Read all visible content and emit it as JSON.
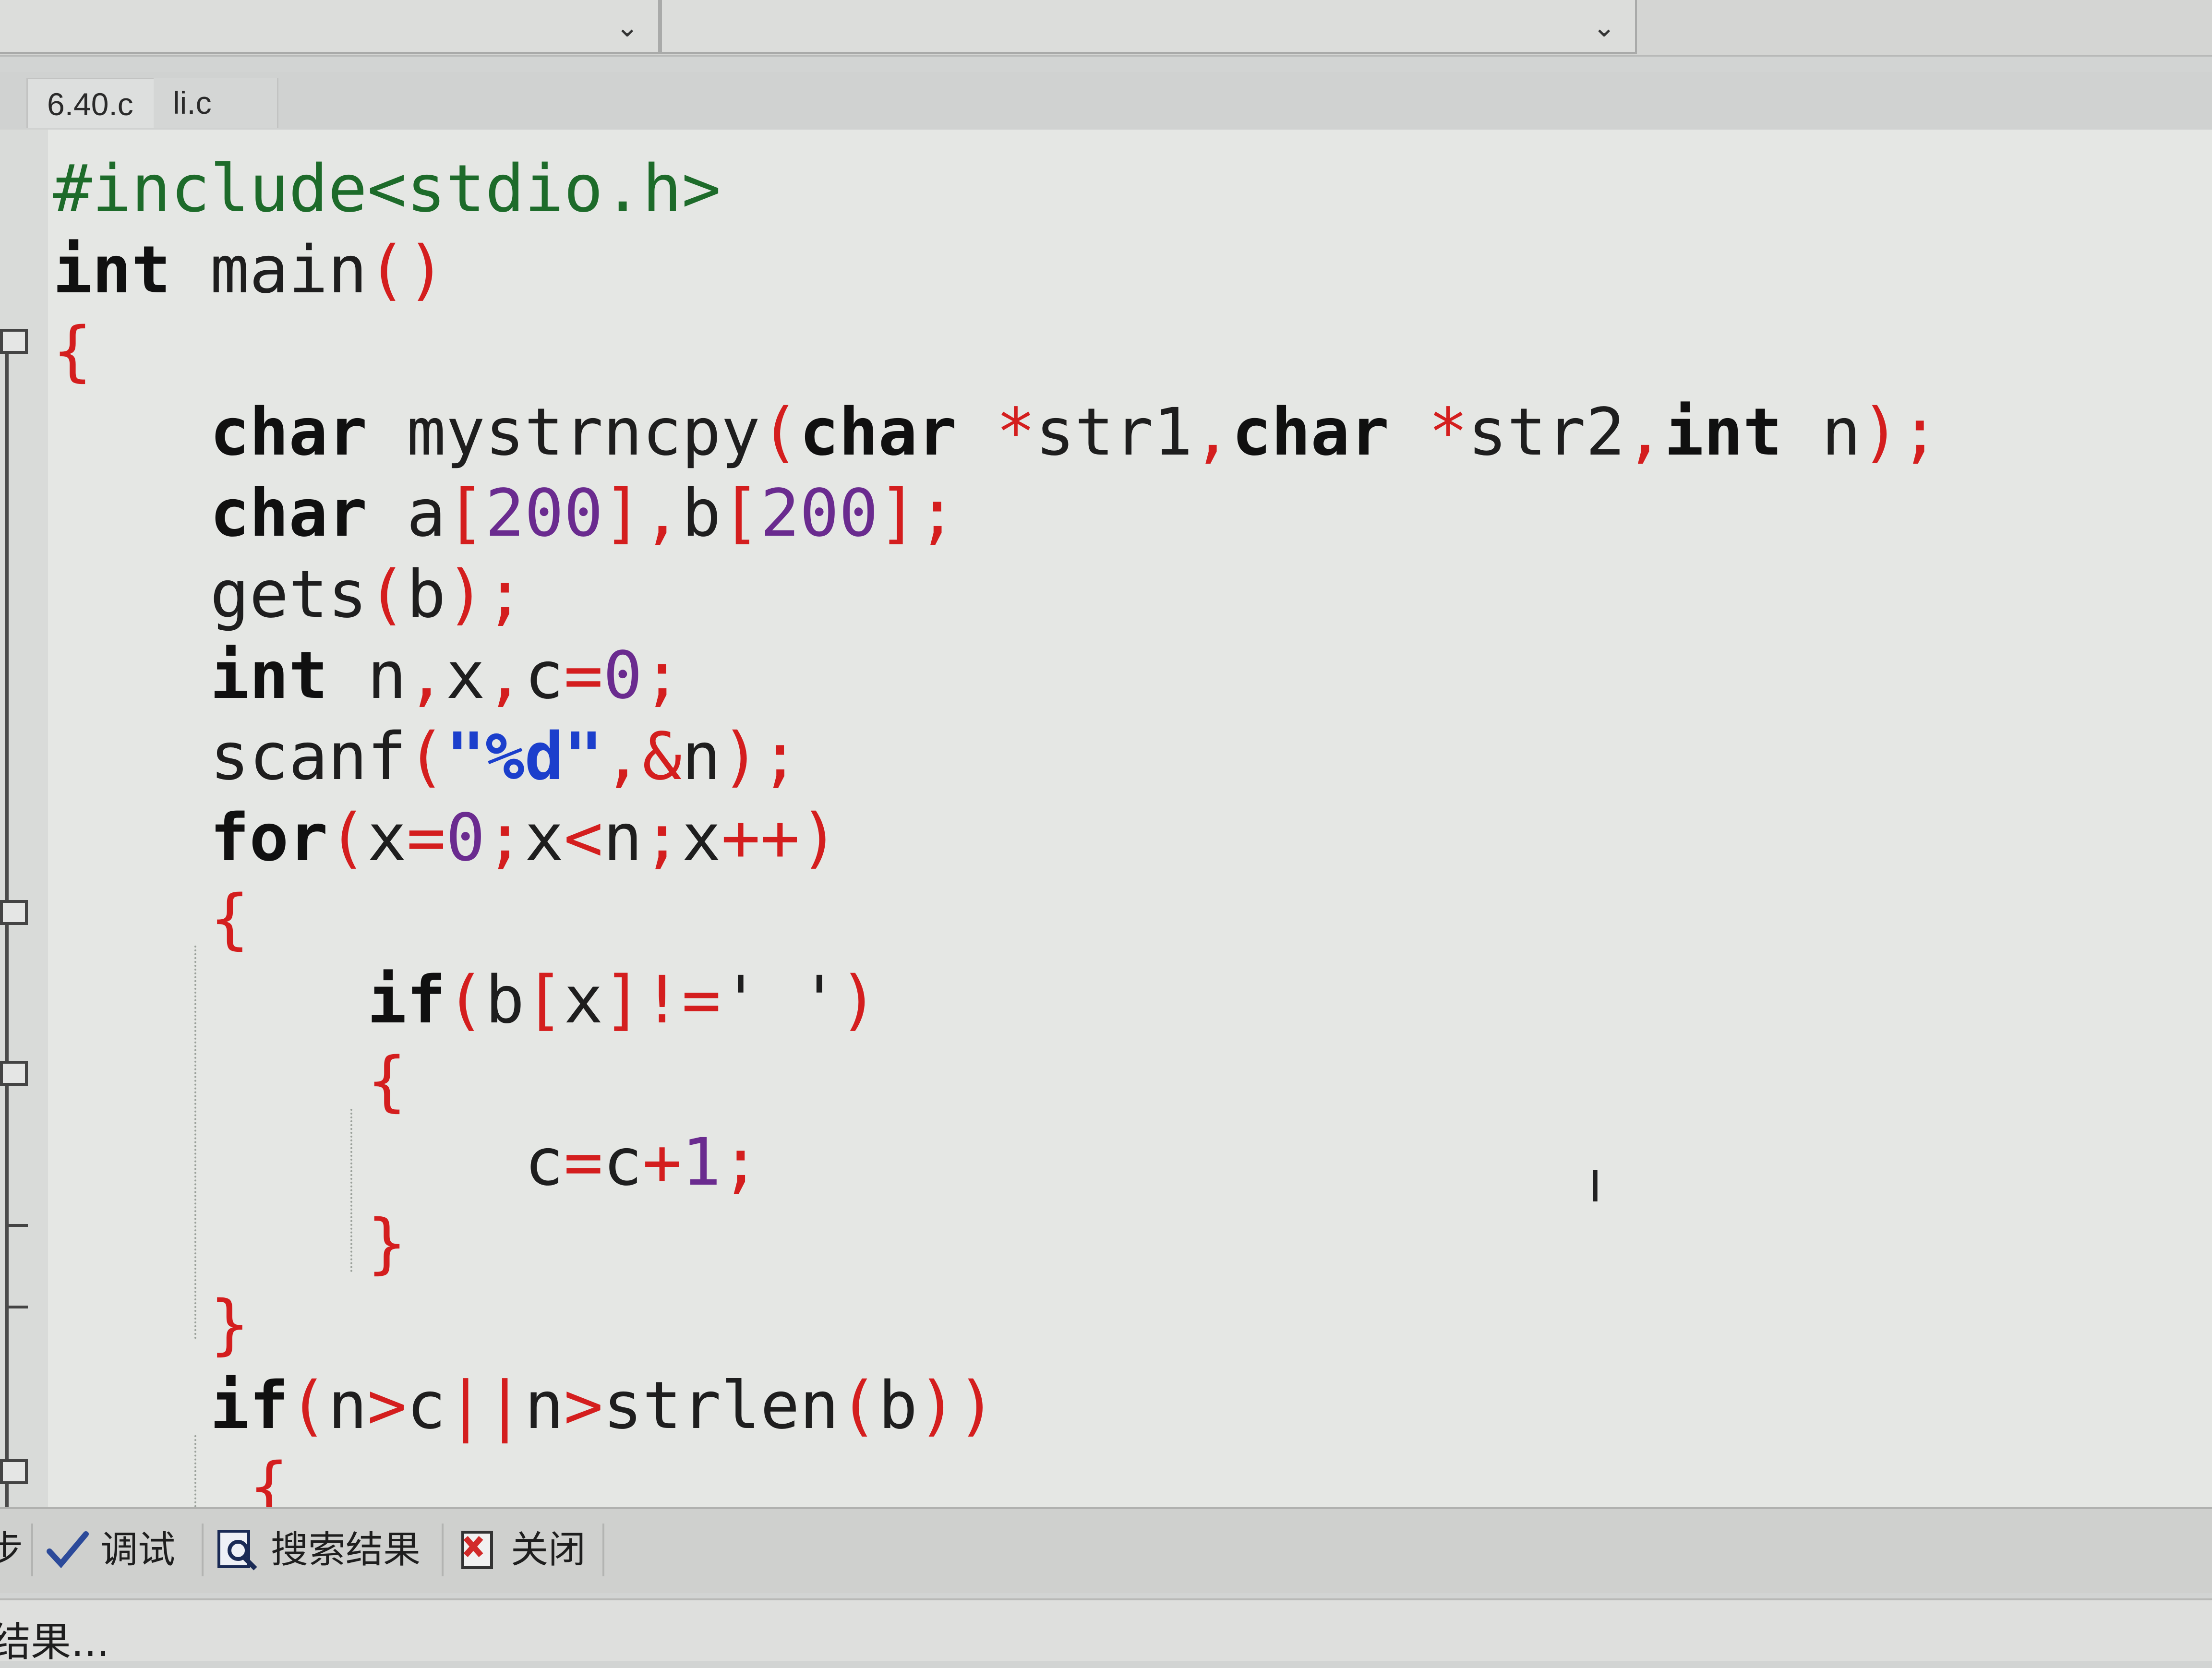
{
  "toolbar": {
    "combo_arrow": "⌄"
  },
  "tabs": [
    {
      "label": "6.40.c"
    },
    {
      "label": "li.c"
    }
  ],
  "code": {
    "lines": [
      "#include<stdio.h>",
      "int main()",
      "{",
      "    char mystrncpy(char *str1,char *str2,int n);",
      "    char a[200],b[200];",
      "    gets(b);",
      "    int n,x,c=0;",
      "    scanf(\"%d\",&n);",
      "    for(x=0;x<n;x++)",
      "    {",
      "        if(b[x]!=' ')",
      "        {",
      "            c=c+1;",
      "        }",
      "    }",
      "    if(n>c||n>strlen(b))",
      "     {"
    ]
  },
  "bottom_tabs": {
    "partial": "步",
    "debug": "调试",
    "search_results": "搜索结果",
    "close": "关闭"
  },
  "status": {
    "text": "结果..."
  },
  "colors": {
    "keyword": "#101010",
    "preprocessor": "#1d6b2a",
    "operator": "#d41e1e",
    "number": "#6a2b8f",
    "string": "#1b3fcc",
    "editor_bg": "#e5e7e4"
  }
}
